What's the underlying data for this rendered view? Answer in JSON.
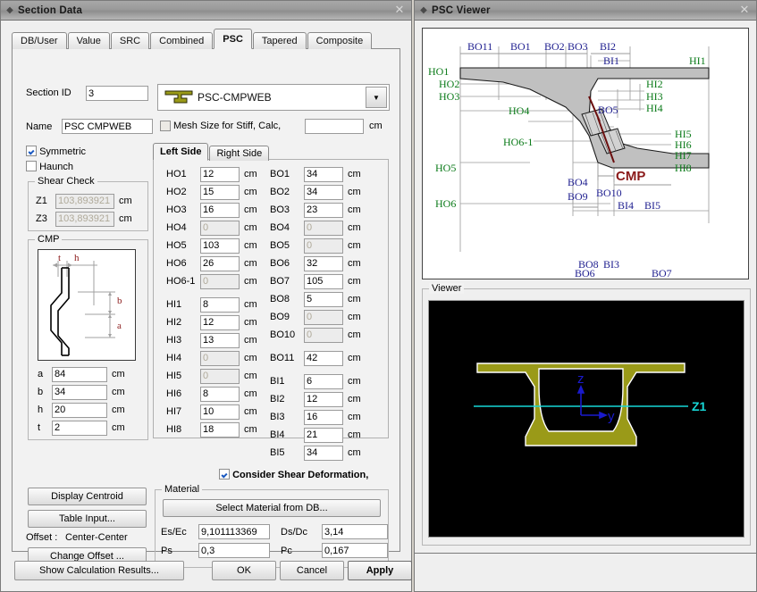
{
  "windows": {
    "section_data": {
      "title": "Section Data"
    },
    "psc_viewer": {
      "title": "PSC Viewer"
    }
  },
  "tabs": [
    {
      "label": "DB/User",
      "active": false
    },
    {
      "label": "Value",
      "active": false
    },
    {
      "label": "SRC",
      "active": false
    },
    {
      "label": "Combined",
      "active": false
    },
    {
      "label": "PSC",
      "active": true
    },
    {
      "label": "Tapered",
      "active": false
    },
    {
      "label": "Composite",
      "active": false
    }
  ],
  "form": {
    "section_id_label": "Section ID",
    "section_id_value": "3",
    "combo_value": "PSC-CMPWEB",
    "combo_arrow": "▼",
    "name_label": "Name",
    "name_value": "PSC CMPWEB",
    "mesh_label": "Mesh Size for Stiff, Calc,",
    "mesh_value": "",
    "mesh_unit": "cm",
    "symmetric_label": "Symmetric",
    "symmetric_checked": true,
    "haunch_label": "Haunch",
    "haunch_checked": false
  },
  "shear_check": {
    "caption": "Shear Check",
    "rows": [
      {
        "label": "Z1",
        "value": "103,893921",
        "unit": "cm"
      },
      {
        "label": "Z3",
        "value": "103,893921",
        "unit": "cm"
      }
    ]
  },
  "cmp": {
    "caption": "CMP",
    "diagram_labels": [
      "t",
      "h",
      "b",
      "a"
    ],
    "rows": [
      {
        "label": "a",
        "value": "84",
        "unit": "cm"
      },
      {
        "label": "b",
        "value": "34",
        "unit": "cm"
      },
      {
        "label": "h",
        "value": "20",
        "unit": "cm"
      },
      {
        "label": "t",
        "value": "2",
        "unit": "cm"
      }
    ]
  },
  "side_tabs": [
    {
      "label": "Left Side",
      "active": true
    },
    {
      "label": "Right Side",
      "active": false
    }
  ],
  "dimensions": {
    "unit": "cm",
    "left_column": [
      {
        "label": "HO1",
        "value": "12",
        "readonly": false
      },
      {
        "label": "HO2",
        "value": "15",
        "readonly": false
      },
      {
        "label": "HO3",
        "value": "16",
        "readonly": false
      },
      {
        "label": "HO4",
        "value": "0",
        "readonly": true
      },
      {
        "label": "HO5",
        "value": "103",
        "readonly": false
      },
      {
        "label": "HO6",
        "value": "26",
        "readonly": false
      },
      {
        "label": "HO6-1",
        "value": "0",
        "readonly": true
      },
      {
        "label": "HI1",
        "value": "8",
        "readonly": false
      },
      {
        "label": "HI2",
        "value": "12",
        "readonly": false
      },
      {
        "label": "HI3",
        "value": "13",
        "readonly": false
      },
      {
        "label": "HI4",
        "value": "0",
        "readonly": true
      },
      {
        "label": "HI5",
        "value": "0",
        "readonly": true
      },
      {
        "label": "HI6",
        "value": "8",
        "readonly": false
      },
      {
        "label": "HI7",
        "value": "10",
        "readonly": false
      },
      {
        "label": "HI8",
        "value": "18",
        "readonly": false
      }
    ],
    "right_column": [
      {
        "label": "BO1",
        "value": "34",
        "readonly": false
      },
      {
        "label": "BO2",
        "value": "34",
        "readonly": false
      },
      {
        "label": "BO3",
        "value": "23",
        "readonly": false
      },
      {
        "label": "BO4",
        "value": "0",
        "readonly": true
      },
      {
        "label": "BO5",
        "value": "0",
        "readonly": true
      },
      {
        "label": "BO6",
        "value": "32",
        "readonly": false
      },
      {
        "label": "BO7",
        "value": "105",
        "readonly": false
      },
      {
        "label": "BO8",
        "value": "5",
        "readonly": false
      },
      {
        "label": "BO9",
        "value": "0",
        "readonly": true
      },
      {
        "label": "BO10",
        "value": "0",
        "readonly": true
      },
      {
        "label": "BO11",
        "value": "42",
        "readonly": false
      },
      {
        "label": "BI1",
        "value": "6",
        "readonly": false
      },
      {
        "label": "BI2",
        "value": "12",
        "readonly": false
      },
      {
        "label": "BI3",
        "value": "16",
        "readonly": false
      },
      {
        "label": "BI4",
        "value": "21",
        "readonly": false
      },
      {
        "label": "BI5",
        "value": "34",
        "readonly": false
      }
    ]
  },
  "shear_deformation": {
    "label": "Consider Shear Deformation,",
    "checked": true
  },
  "material": {
    "caption": "Material",
    "select_button": "Select Material from DB...",
    "fields": [
      {
        "label": "Es/Ec",
        "value": "9,101113369"
      },
      {
        "label": "Ds/Dc",
        "value": "3,14"
      },
      {
        "label": "Ps",
        "value": "0,3"
      },
      {
        "label": "Pc",
        "value": "0,167"
      }
    ]
  },
  "actions": {
    "display_centroid": "Display Centroid",
    "table_input": "Table Input...",
    "offset_label": "Offset :",
    "offset_value": "Center-Center",
    "change_offset": "Change Offset ...",
    "show_calc": "Show Calculation Results...",
    "ok": "OK",
    "cancel": "Cancel",
    "apply": "Apply"
  },
  "drawing": {
    "blue_labels": [
      "BO11",
      "BO1",
      "BO2",
      "BO3",
      "BI2",
      "BI1",
      "BO5",
      "BO4",
      "BO9",
      "BO10",
      "BI4",
      "BI5",
      "BO8",
      "BI3",
      "BO6",
      "BO7"
    ],
    "green_labels": [
      "HO1",
      "HO2",
      "HO3",
      "HO4",
      "HO5",
      "HO6",
      "HO6-1",
      "HI1",
      "HI2",
      "HI3",
      "HI4",
      "HI5",
      "HI6",
      "HI7",
      "HI8"
    ],
    "cmp_label": "CMP",
    "colors": {
      "blue": "#202090",
      "green": "#0a7a18",
      "cmp_red": "#8b1a1a",
      "fill": "#c0c0c0"
    }
  },
  "viewer": {
    "caption": "Viewer",
    "axis_z": "z",
    "axis_y": "y",
    "marker": "Z1",
    "colors": {
      "section": "#9a9a18",
      "background": "#000000",
      "axis": "#1a1acd",
      "line": "#17d7d7"
    }
  }
}
